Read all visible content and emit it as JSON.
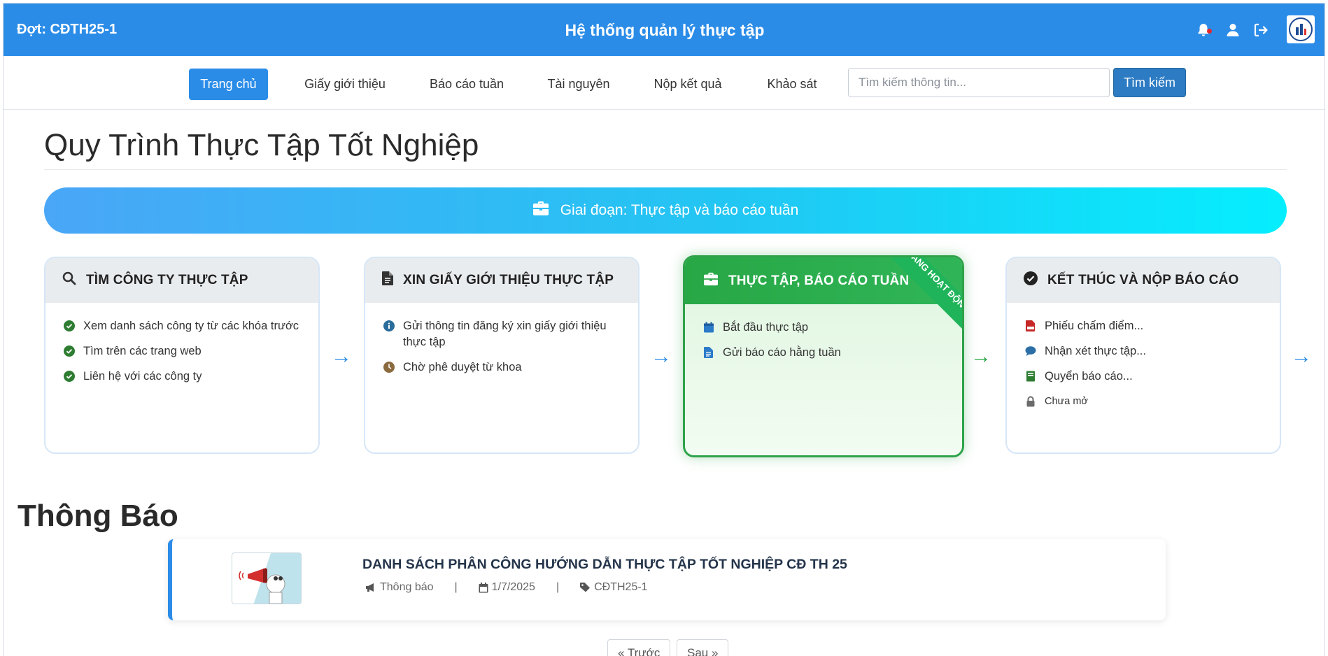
{
  "header": {
    "period": "Đợt: CĐTH25-1",
    "title": "Hệ thống quản lý thực tập",
    "icons": [
      "bell-icon",
      "user-icon",
      "logout-icon",
      "school-logo"
    ]
  },
  "nav": {
    "items": [
      {
        "label": "Trang chủ",
        "active": true
      },
      {
        "label": "Giấy giới thiệu"
      },
      {
        "label": "Báo cáo tuần"
      },
      {
        "label": "Tài nguyên"
      },
      {
        "label": "Nộp kết quả"
      },
      {
        "label": "Khảo sát"
      }
    ],
    "search_placeholder": "Tìm kiếm thông tin...",
    "search_button": "Tìm kiếm"
  },
  "main": {
    "title": "Quy Trình Thực Tập Tốt Nghiệp",
    "phase": "Giai đoạn: Thực tập và báo cáo tuần",
    "steps": [
      {
        "title": "TÌM CÔNG TY THỰC TẬP",
        "icon": "search-icon",
        "items": [
          {
            "text": "Xem danh sách công ty từ các khóa trước",
            "icon": "check-circle-icon"
          },
          {
            "text": "Tìm trên các trang web",
            "icon": "check-circle-icon"
          },
          {
            "text": "Liên hệ với các công ty",
            "icon": "check-circle-icon"
          }
        ]
      },
      {
        "title": "XIN GIẤY GIỚI THIỆU THỰC TẬP",
        "icon": "file-icon",
        "items": [
          {
            "text": "Gửi thông tin đăng ký xin giấy giới thiệu thực tập",
            "icon": "info-circle-icon"
          },
          {
            "text": "Chờ phê duyệt từ khoa",
            "icon": "clock-icon"
          }
        ]
      },
      {
        "title": "THỰC TẬP, BÁO CÁO TUẦN",
        "icon": "briefcase-icon",
        "active": true,
        "ribbon": "ĐANG HOẠT ĐỘNG",
        "items": [
          {
            "text": "Bắt đầu thực tập",
            "icon": "calendar-icon"
          },
          {
            "text": "Gửi báo cáo hằng tuần",
            "icon": "file-icon"
          }
        ]
      },
      {
        "title": "KẾT THÚC VÀ NỘP BÁO CÁO",
        "icon": "check-circle-icon",
        "items": [
          {
            "text": "Phiếu chấm điểm...",
            "icon": "pdf-icon"
          },
          {
            "text": "Nhận xét thực tập...",
            "icon": "comment-icon"
          },
          {
            "text": "Quyển báo cáo...",
            "icon": "book-icon"
          },
          {
            "text": "Chưa mở",
            "icon": "lock-icon"
          }
        ]
      }
    ],
    "arrows": [
      "→",
      "→",
      "→",
      "→"
    ]
  },
  "announcements": {
    "title": "Thông Báo",
    "items": [
      {
        "title": "DANH SÁCH PHÂN CÔNG HƯỚNG DẪN THỰC TẬP TỐT NGHIỆP CĐ TH 25",
        "category": "Thông báo",
        "date": "1/7/2025",
        "tag": "CĐTH25-1",
        "separator": "|"
      }
    ],
    "pager": {
      "prev": "« Trước",
      "next": "Sau »"
    }
  },
  "colors": {
    "primary": "#2b8ce8",
    "success": "#28a745",
    "phase_gradient_start": "#4aa6f7",
    "phase_gradient_end": "#05eefe"
  }
}
